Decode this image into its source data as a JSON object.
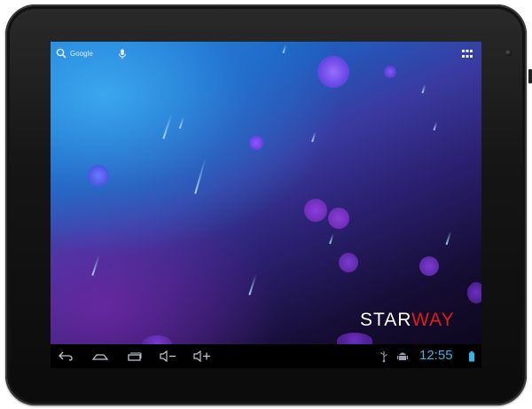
{
  "device": {
    "bezel_color": "#141414"
  },
  "wallpaper": {
    "orb_color": "#8a4cf0",
    "streak_color": "#bfe6ff"
  },
  "home": {
    "search_label": "Google",
    "search_icon": "search-icon",
    "voice_icon": "microphone-icon",
    "apps_icon": "all-apps-grid-icon"
  },
  "brand": {
    "prefix": "STAR",
    "suffix": "WAY",
    "accent_color": "#e01b22"
  },
  "navbar": {
    "back_icon": "back-icon",
    "home_icon": "home-icon",
    "recents_icon": "recent-apps-icon",
    "volume_down_icon": "volume-down-icon",
    "volume_up_icon": "volume-up-icon",
    "usb_icon": "usb-icon",
    "debug_icon": "android-debug-icon",
    "battery_icon": "battery-icon",
    "clock": "12:55",
    "clock_color": "#33b5e5"
  }
}
